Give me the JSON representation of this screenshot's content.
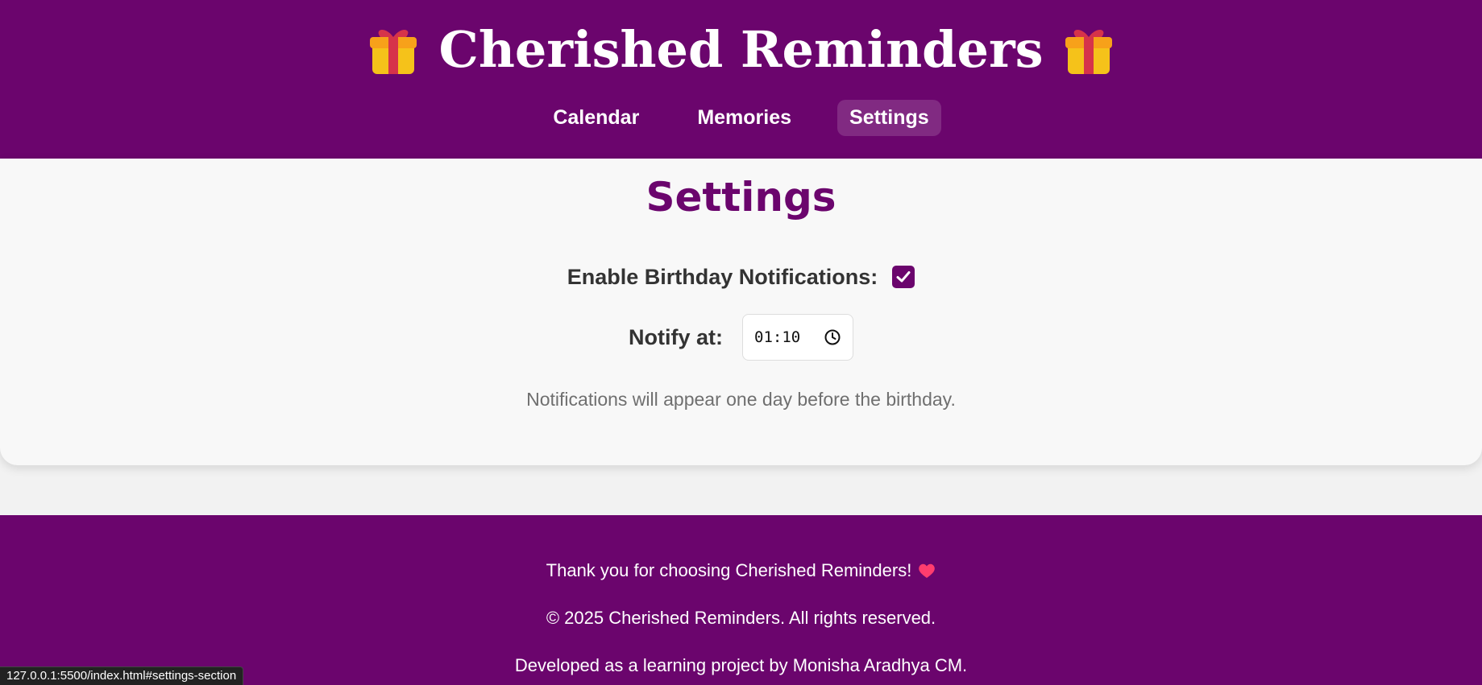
{
  "header": {
    "title": "Cherished Reminders",
    "left_icon": "gift-icon",
    "right_icon": "gift-icon",
    "nav": [
      {
        "label": "Calendar",
        "active": false
      },
      {
        "label": "Memories",
        "active": false
      },
      {
        "label": "Settings",
        "active": true
      }
    ]
  },
  "settings": {
    "heading": "Settings",
    "notifications_label": "Enable Birthday Notifications:",
    "notifications_enabled": true,
    "notify_at_label": "Notify at:",
    "notify_time": "01:10",
    "help_text": "Notifications will appear one day before the birthday."
  },
  "footer": {
    "thanks": "Thank you for choosing Cherished Reminders!",
    "copyright": "© 2025 Cherished Reminders. All rights reserved.",
    "credit": "Developed as a learning project by Monisha Aradhya CM."
  },
  "status_bar": {
    "url": "127.0.0.1:5500/index.html#settings-section"
  },
  "colors": {
    "brand_purple": "#6b056d",
    "background": "#f8f8f8",
    "heart": "#ff3d6e"
  }
}
